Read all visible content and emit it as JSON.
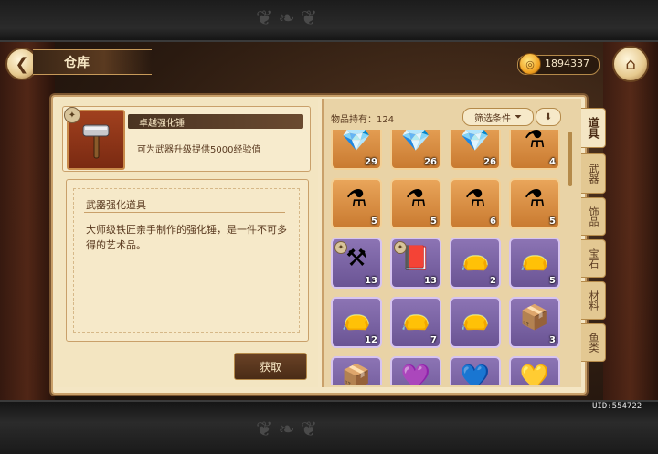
{
  "header": {
    "title": "仓库",
    "back_icon": "back-arrow-icon",
    "home_icon": "home-icon",
    "gold": "1894337"
  },
  "selected_item": {
    "name": "卓越强化锤",
    "short_desc": "可为武器升级提供5000经验值",
    "category": "武器强化道具",
    "description": "大师级铁匠亲手制作的强化锤，是一件不可多得的艺术品。",
    "obtain_label": "获取"
  },
  "inventory": {
    "count_label": "物品持有：124",
    "filter_label": "筛选条件",
    "rows": [
      [
        {
          "icon": "green-gem-icon",
          "qty": "29",
          "rarity": "orange"
        },
        {
          "icon": "blue-gem-icon",
          "qty": "26",
          "rarity": "orange"
        },
        {
          "icon": "yellow-gem-icon",
          "qty": "26",
          "rarity": "orange"
        },
        {
          "icon": "potion-icon",
          "qty": "4",
          "rarity": "orange"
        }
      ],
      [
        {
          "icon": "green-potion-icon",
          "qty": "5",
          "rarity": "orange"
        },
        {
          "icon": "blue-potion-icon",
          "qty": "5",
          "rarity": "orange"
        },
        {
          "icon": "gold-potion-icon",
          "qty": "6",
          "rarity": "orange"
        },
        {
          "icon": "purple-potion-icon",
          "qty": "5",
          "rarity": "orange"
        }
      ],
      [
        {
          "icon": "hammer-icon",
          "qty": "13",
          "rarity": "purple",
          "star": true
        },
        {
          "icon": "book-icon",
          "qty": "13",
          "rarity": "purple",
          "star": true
        },
        {
          "icon": "red-pouch-icon",
          "qty": "2",
          "rarity": "purple"
        },
        {
          "icon": "red-pouch-icon",
          "qty": "5",
          "rarity": "purple"
        }
      ],
      [
        {
          "icon": "green-pouch-icon",
          "qty": "12",
          "rarity": "purple"
        },
        {
          "icon": "blue-pouch-icon",
          "qty": "7",
          "rarity": "purple"
        },
        {
          "icon": "blue-pouch-icon",
          "qty": "",
          "rarity": "purple"
        },
        {
          "icon": "crate-icon",
          "qty": "3",
          "rarity": "purple"
        }
      ],
      [
        {
          "icon": "green-crate-icon",
          "qty": "",
          "rarity": "purple"
        },
        {
          "icon": "purple-heart-gem-icon",
          "qty": "",
          "rarity": "purple"
        },
        {
          "icon": "blue-heart-gem-icon",
          "qty": "",
          "rarity": "purple"
        },
        {
          "icon": "gold-heart-gem-icon",
          "qty": "",
          "rarity": "purple"
        }
      ]
    ]
  },
  "tabs": [
    {
      "label": "道具",
      "active": true
    },
    {
      "label": "武器",
      "active": false
    },
    {
      "label": "饰品",
      "active": false
    },
    {
      "label": "宝石",
      "active": false
    },
    {
      "label": "材料",
      "active": false
    },
    {
      "label": "鱼类",
      "active": false
    }
  ],
  "uid": "UID:554722",
  "colors": {
    "accent": "#c9a06a",
    "panel": "#f4e6c4",
    "rarity_orange": "#e9a55a",
    "rarity_purple": "#8c74b4"
  }
}
